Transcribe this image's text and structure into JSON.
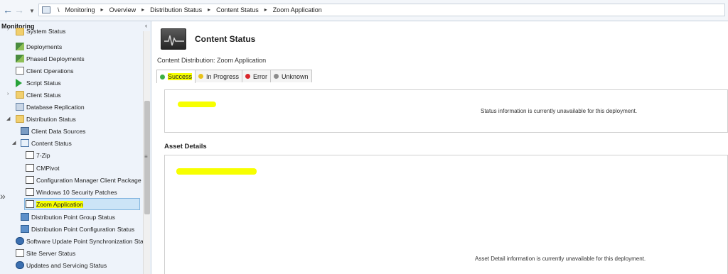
{
  "breadcrumb": {
    "root_sep": "\\",
    "items": [
      "Monitoring",
      "Overview",
      "Distribution Status",
      "Content Status",
      "Zoom Application"
    ]
  },
  "nav": {
    "back_icon": "back-arrow-icon",
    "forward_icon": "forward-arrow-icon"
  },
  "leftpane": {
    "title": "Monitoring",
    "items": [
      {
        "label": "System Status",
        "icon": "folder-icon"
      },
      {
        "label": "Deployments",
        "icon": "deployments-icon"
      },
      {
        "label": "Phased Deployments",
        "icon": "phased-deployments-icon"
      },
      {
        "label": "Client Operations",
        "icon": "client-operations-icon"
      },
      {
        "label": "Script Status",
        "icon": "play-icon"
      },
      {
        "label": "Client Status",
        "icon": "folder-icon"
      },
      {
        "label": "Database Replication",
        "icon": "database-icon"
      },
      {
        "label": "Distribution Status",
        "icon": "folder-icon"
      },
      {
        "label": "Client Data Sources",
        "icon": "data-sources-icon"
      },
      {
        "label": "Content Status",
        "icon": "content-status-icon"
      },
      {
        "label": "7-Zip",
        "icon": "application-icon"
      },
      {
        "label": "CMPivot",
        "icon": "application-icon"
      },
      {
        "label": "Configuration Manager Client Package",
        "icon": "package-icon"
      },
      {
        "label": "Windows 10 Security Patches",
        "icon": "package-icon"
      },
      {
        "label": "Zoom Application",
        "icon": "application-icon"
      },
      {
        "label": "Distribution Point Group Status",
        "icon": "dp-group-icon"
      },
      {
        "label": "Distribution Point Configuration Status",
        "icon": "dp-config-icon"
      },
      {
        "label": "Software Update Point Synchronization Sta",
        "icon": "sup-sync-icon"
      },
      {
        "label": "Site Server Status",
        "icon": "site-server-icon"
      },
      {
        "label": "Updates and Servicing Status",
        "icon": "updates-icon"
      }
    ]
  },
  "main": {
    "title": "Content Status",
    "distribution_label": "Content Distribution: Zoom Application",
    "tabs": [
      {
        "label": "Success",
        "color": "#3cb043"
      },
      {
        "label": "In Progress",
        "color": "#e8c21a"
      },
      {
        "label": "Error",
        "color": "#d9262b"
      },
      {
        "label": "Unknown",
        "color": "#8c8c8c"
      }
    ],
    "status_message": "Status information is currently unavailable for this deployment.",
    "asset_title": "Asset Details",
    "asset_message": "Asset Detail information is currently unavailable for this deployment."
  },
  "colors": {
    "highlight": "#f7ff00",
    "selection": "#cce4f7",
    "pane_bg": "#eef3fa"
  }
}
